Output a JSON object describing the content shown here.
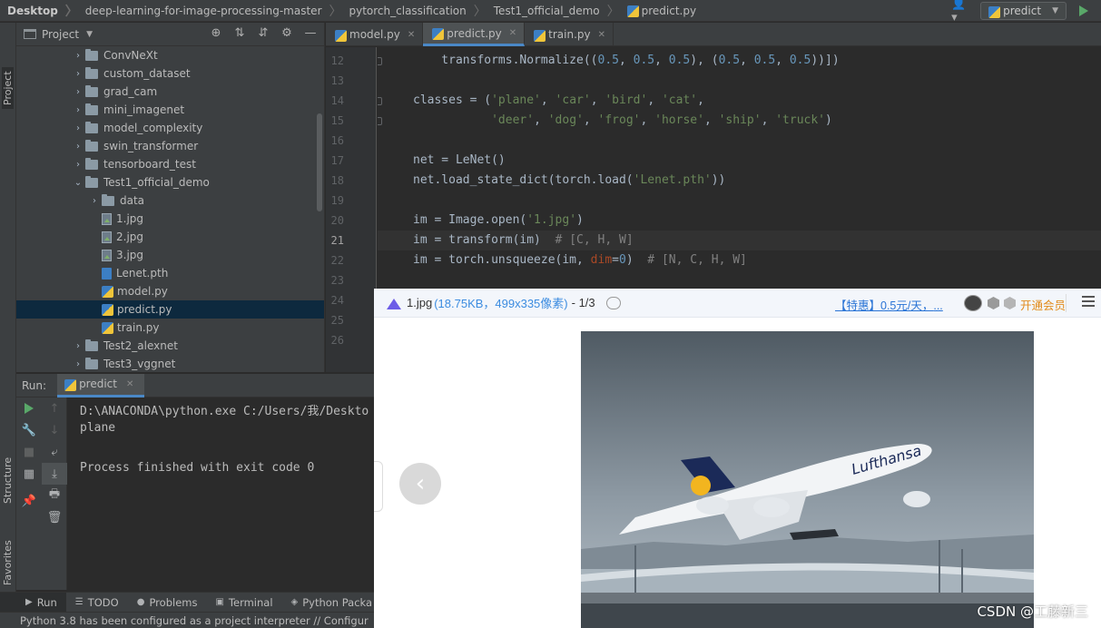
{
  "breadcrumbs": [
    "Desktop",
    "deep-learning-for-image-processing-master",
    "pytorch_classification",
    "Test1_official_demo",
    "predict.py"
  ],
  "run_config": {
    "label": "predict"
  },
  "side_tabs": {
    "project": "Project",
    "structure": "Structure",
    "favorites": "Favorites"
  },
  "project_panel": {
    "title": "Project"
  },
  "tree": [
    {
      "label": "ConvNeXt",
      "type": "folder",
      "depth": 0,
      "expanded": false
    },
    {
      "label": "custom_dataset",
      "type": "folder",
      "depth": 0,
      "expanded": false
    },
    {
      "label": "grad_cam",
      "type": "folder",
      "depth": 0,
      "expanded": false
    },
    {
      "label": "mini_imagenet",
      "type": "folder",
      "depth": 0,
      "expanded": false
    },
    {
      "label": "model_complexity",
      "type": "folder",
      "depth": 0,
      "expanded": false
    },
    {
      "label": "swin_transformer",
      "type": "folder",
      "depth": 0,
      "expanded": false
    },
    {
      "label": "tensorboard_test",
      "type": "folder",
      "depth": 0,
      "expanded": false
    },
    {
      "label": "Test1_official_demo",
      "type": "folder",
      "depth": 0,
      "expanded": true
    },
    {
      "label": "data",
      "type": "folder",
      "depth": 1,
      "expanded": false
    },
    {
      "label": "1.jpg",
      "type": "image",
      "depth": 1
    },
    {
      "label": "2.jpg",
      "type": "image",
      "depth": 1
    },
    {
      "label": "3.jpg",
      "type": "image",
      "depth": 1
    },
    {
      "label": "Lenet.pth",
      "type": "pth",
      "depth": 1
    },
    {
      "label": "model.py",
      "type": "py",
      "depth": 1
    },
    {
      "label": "predict.py",
      "type": "py",
      "depth": 1,
      "selected": true
    },
    {
      "label": "train.py",
      "type": "py",
      "depth": 1
    },
    {
      "label": "Test2_alexnet",
      "type": "folder",
      "depth": 0,
      "expanded": false
    },
    {
      "label": "Test3_vggnet",
      "type": "folder",
      "depth": 0,
      "expanded": false
    }
  ],
  "editor": {
    "tabs": [
      {
        "label": "model.py",
        "active": false
      },
      {
        "label": "predict.py",
        "active": true
      },
      {
        "label": "train.py",
        "active": false
      }
    ],
    "current_line": 21,
    "lines": [
      {
        "no": 12,
        "tokens": [
          [
            "    transforms.Normalize((",
            ""
          ],
          [
            "0.5",
            "num"
          ],
          [
            ", ",
            ""
          ],
          [
            "0.5",
            "num"
          ],
          [
            ", ",
            ""
          ],
          [
            "0.5",
            "num"
          ],
          [
            "), (",
            ""
          ],
          [
            "0.5",
            "num"
          ],
          [
            ", ",
            ""
          ],
          [
            "0.5",
            "num"
          ],
          [
            ", ",
            ""
          ],
          [
            "0.5",
            "num"
          ],
          [
            "))])",
            ""
          ]
        ]
      },
      {
        "no": 13,
        "tokens": []
      },
      {
        "no": 14,
        "tokens": [
          [
            "classes = (",
            ""
          ],
          [
            "'plane'",
            "str"
          ],
          [
            ", ",
            ""
          ],
          [
            "'car'",
            "str"
          ],
          [
            ", ",
            ""
          ],
          [
            "'bird'",
            "str"
          ],
          [
            ", ",
            ""
          ],
          [
            "'cat'",
            "str"
          ],
          [
            ",",
            ""
          ]
        ]
      },
      {
        "no": 15,
        "tokens": [
          [
            "           ",
            ""
          ],
          [
            "'deer'",
            "str"
          ],
          [
            ", ",
            ""
          ],
          [
            "'dog'",
            "str"
          ],
          [
            ", ",
            ""
          ],
          [
            "'frog'",
            "str"
          ],
          [
            ", ",
            ""
          ],
          [
            "'horse'",
            "str"
          ],
          [
            ", ",
            ""
          ],
          [
            "'ship'",
            "str"
          ],
          [
            ", ",
            ""
          ],
          [
            "'truck'",
            "str"
          ],
          [
            ")",
            ""
          ]
        ]
      },
      {
        "no": 16,
        "tokens": []
      },
      {
        "no": 17,
        "tokens": [
          [
            "net = LeNet()",
            ""
          ]
        ]
      },
      {
        "no": 18,
        "tokens": [
          [
            "net.load_state_dict(torch.load(",
            ""
          ],
          [
            "'Lenet.pth'",
            "str"
          ],
          [
            "))",
            ""
          ]
        ]
      },
      {
        "no": 19,
        "tokens": []
      },
      {
        "no": 20,
        "tokens": [
          [
            "im = Image.open(",
            ""
          ],
          [
            "'1.jpg'",
            "str"
          ],
          [
            ")",
            ""
          ]
        ]
      },
      {
        "no": 21,
        "tokens": [
          [
            "im = transform(im)  ",
            ""
          ],
          [
            "# [C, H, W]",
            "cmt"
          ]
        ]
      },
      {
        "no": 22,
        "tokens": [
          [
            "im = torch.unsqueeze(im, ",
            ""
          ],
          [
            "dim",
            "kw"
          ],
          [
            "=",
            ""
          ],
          [
            "0",
            "num"
          ],
          [
            ")  ",
            ""
          ],
          [
            "# [N, C, H, W]",
            "cmt"
          ]
        ]
      },
      {
        "no": 23,
        "tokens": []
      },
      {
        "no": 24,
        "tokens": []
      },
      {
        "no": 25,
        "tokens": []
      },
      {
        "no": 26,
        "tokens": []
      }
    ]
  },
  "run_panel": {
    "label": "Run:",
    "tab": "predict",
    "output": [
      "D:\\ANACONDA\\python.exe C:/Users/我/Deskto",
      "plane",
      "",
      "Process finished with exit code 0"
    ]
  },
  "bottom_tools": [
    {
      "label": "Run",
      "icon": "play-icon",
      "active": true
    },
    {
      "label": "TODO",
      "icon": "list-icon",
      "active": false
    },
    {
      "label": "Problems",
      "icon": "info-icon",
      "active": false
    },
    {
      "label": "Terminal",
      "icon": "terminal-icon",
      "active": false
    },
    {
      "label": "Python Packa",
      "icon": "package-icon",
      "active": false
    }
  ],
  "status_bar": {
    "text": "Python 3.8 has been configured as a project interpreter // Configur"
  },
  "viewer": {
    "filename": "1.jpg",
    "meta": "(18.75KB，499x335像素)",
    "page": "- 1/3",
    "promo": "【特惠】0.5元/天，",
    "promo_more": "...",
    "vip": "开通会员",
    "photo_text": "Lufthansa",
    "watermark": "CSDN @工藤新三"
  },
  "colors": {
    "ide_bg": "#2b2b2b",
    "panel_bg": "#3c3f41",
    "selection": "#0d293e",
    "accent": "#4a88c7",
    "string": "#6a8759",
    "number": "#6897bb"
  }
}
